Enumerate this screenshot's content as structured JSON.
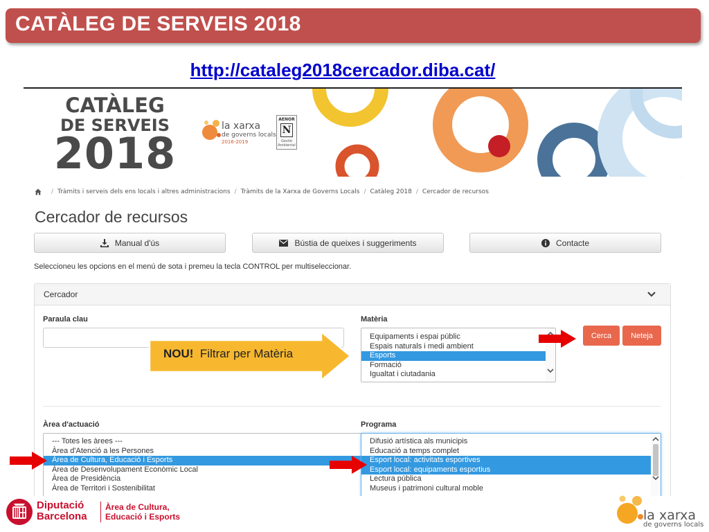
{
  "slide": {
    "title": "CATÀLEG DE SERVEIS 2018",
    "url": "http://cataleg2018cercador.diba.cat/"
  },
  "banner": {
    "title_line1": "CATÀLEG",
    "title_line2": "DE SERVEIS",
    "title_line3": "2018",
    "xarxa_line1": "la xarxa",
    "xarxa_line2": "de governs locals",
    "xarxa_years": "2016-2019",
    "cert_name": "AENOR",
    "cert_caption": "Gestió Ambiental"
  },
  "breadcrumb": {
    "items": [
      "Tràmits i serveis dels ens locals i altres administracions",
      "Tràmits de la Xarxa de Governs Locals",
      "Catàleg 2018",
      "Cercador de recursos"
    ]
  },
  "page": {
    "title": "Cercador de recursos",
    "instructions": "Seleccioneu les opcions en el menú de sota i premeu la tecla CONTROL per multiseleccionar."
  },
  "toolbar": {
    "manual_label": "Manual d'ús",
    "bustia_label": "Bústia de queixes i suggeriments",
    "contacte_label": "Contacte"
  },
  "panel": {
    "title": "Cercador",
    "keyword_label": "Paraula clau",
    "keyword_value": "",
    "materia_label": "Matèria",
    "materia_options": [
      {
        "label": "Equipaments i espai públic",
        "selected": false
      },
      {
        "label": "Espais naturals i medi ambient",
        "selected": false
      },
      {
        "label": "Esports",
        "selected": true
      },
      {
        "label": "Formació",
        "selected": false
      },
      {
        "label": "Igualtat i ciutadania",
        "selected": false
      }
    ],
    "area_label": "Àrea d'actuació",
    "area_options": [
      {
        "label": "--- Totes les àrees ---",
        "selected": false
      },
      {
        "label": "Àrea d'Atenció a les Persones",
        "selected": false
      },
      {
        "label": "Àrea de Cultura, Educació i Esports",
        "selected": true
      },
      {
        "label": "Àrea de Desenvolupament Econòmic Local",
        "selected": false
      },
      {
        "label": "Àrea de Presidència",
        "selected": false
      },
      {
        "label": "Àrea de Territori i Sostenibilitat",
        "selected": false
      }
    ],
    "programa_label": "Programa",
    "programa_options": [
      {
        "label": "Difusió artística als municipis",
        "selected": false
      },
      {
        "label": "Educació a temps complet",
        "selected": false
      },
      {
        "label": "Esport local: activitats esportives",
        "selected": true
      },
      {
        "label": "Esport local: equipaments esportius",
        "selected": true
      },
      {
        "label": "Lectura pública",
        "selected": false
      },
      {
        "label": "Museus i patrimoni cultural moble",
        "selected": false
      }
    ],
    "search_label": "Cerca",
    "clear_label": "Neteja"
  },
  "callout": {
    "strong": "NOU!",
    "text": "Filtrar per Matèria"
  },
  "footer": {
    "org_line1": "Diputació",
    "org_line2": "Barcelona",
    "area_line1": "Àrea de Cultura,",
    "area_line2": "Educació i Esports",
    "xarxa_line1": "la xarxa",
    "xarxa_line2": "de governs locals"
  },
  "colors": {
    "header": "#c0504d",
    "link": "#0000cc",
    "selection": "#3399e0",
    "primary_button": "#e8674d",
    "callout": "#f7b830",
    "arrow": "#e60000",
    "dipu_red": "#c8102e"
  }
}
